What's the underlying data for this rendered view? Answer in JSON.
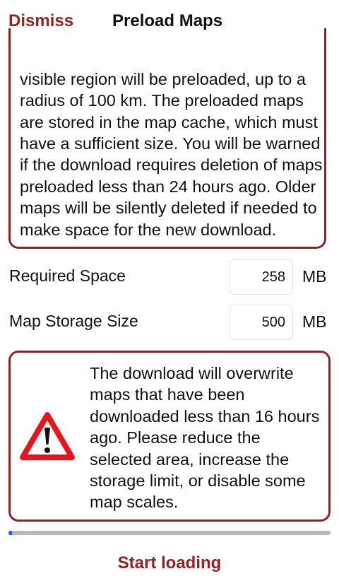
{
  "nav": {
    "dismiss_label": "Dismiss",
    "title": "Preload Maps"
  },
  "info": {
    "text": "visible region will be preloaded, up to a radius of 100 km. The preloaded maps are stored in the map cache, which must have a sufficient size. You will be warned if the download requires deletion of maps preloaded less than 24 hours ago. Older maps will be silently deleted if needed to make space for the new download."
  },
  "required_space": {
    "label": "Required Space",
    "value": "258",
    "unit": "MB"
  },
  "storage_size": {
    "label": "Map Storage Size",
    "value": "500",
    "unit": "MB"
  },
  "warning": {
    "icon": "warning-triangle-icon",
    "text": "The download will overwrite maps that have been downloaded less than 16 hours ago. Please reduce the selected area, increase the storage limit, or disable some map scales."
  },
  "progress": {
    "fraction": 0.012
  },
  "actions": {
    "start_label": "Start loading"
  },
  "colors": {
    "accent": "#8e2424",
    "warning_red": "#e8141c",
    "progress_fill": "#1e5bf0",
    "progress_track": "#b8b8b8"
  }
}
